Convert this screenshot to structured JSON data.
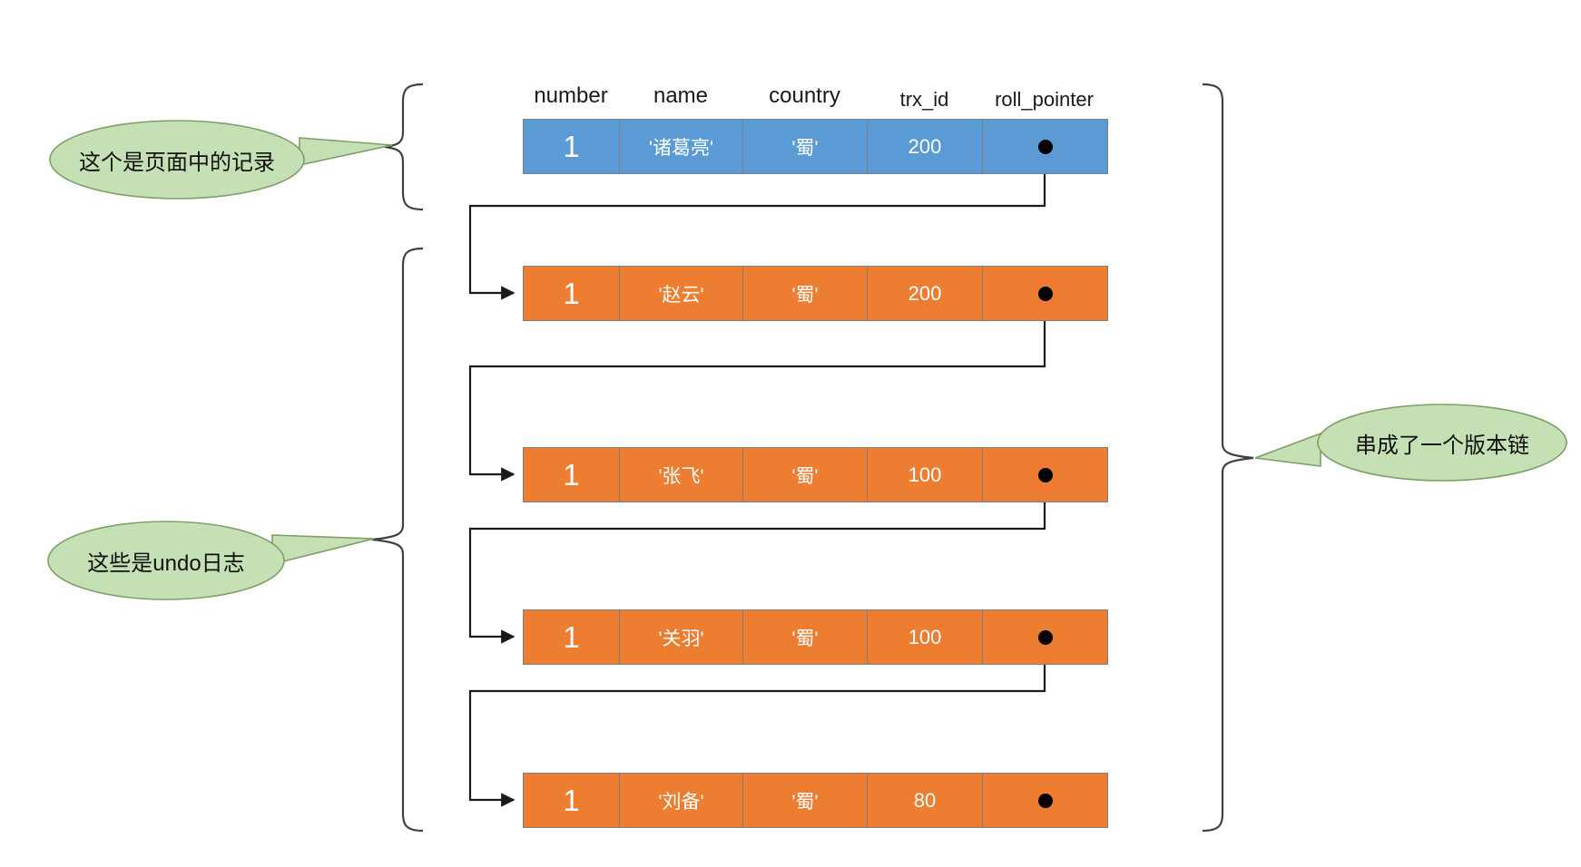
{
  "diagram": {
    "title": "MVCC undo log version chain",
    "colors": {
      "record_fill": "#5b9bd5",
      "undo_fill": "#ed7d31",
      "callout_fill": "#c5e0b4",
      "callout_stroke": "#7f9f67",
      "line": "#404040",
      "text_light": "#ffffff",
      "text_dark": "#1a1a1a"
    },
    "columns": [
      {
        "key": "number",
        "label": "number"
      },
      {
        "key": "name",
        "label": "name"
      },
      {
        "key": "country",
        "label": "country"
      },
      {
        "key": "trx_id",
        "label": "trx_id"
      },
      {
        "key": "roll_pointer",
        "label": "roll_pointer"
      }
    ],
    "record": {
      "kind": "page-record",
      "number": "1",
      "name": "'诸葛亮'",
      "country": "'蜀'",
      "trx_id": "200",
      "roll_pointer": "pointer-dot"
    },
    "undo_logs": [
      {
        "kind": "undo-log",
        "index": 1,
        "number": "1",
        "name": "'赵云'",
        "country": "'蜀'",
        "trx_id": "200",
        "roll_pointer": "pointer-dot"
      },
      {
        "kind": "undo-log",
        "index": 2,
        "number": "1",
        "name": "'张飞'",
        "country": "'蜀'",
        "trx_id": "100",
        "roll_pointer": "pointer-dot"
      },
      {
        "kind": "undo-log",
        "index": 3,
        "number": "1",
        "name": "'关羽'",
        "country": "'蜀'",
        "trx_id": "100",
        "roll_pointer": "pointer-dot"
      },
      {
        "kind": "undo-log",
        "index": 4,
        "number": "1",
        "name": "'刘备'",
        "country": "'蜀'",
        "trx_id": "80",
        "roll_pointer": "pointer-dot"
      }
    ],
    "callouts": {
      "record_note": "这个是页面中的记录",
      "undo_note": "这些是undo日志",
      "chain_note": "串成了一个版本链"
    }
  }
}
